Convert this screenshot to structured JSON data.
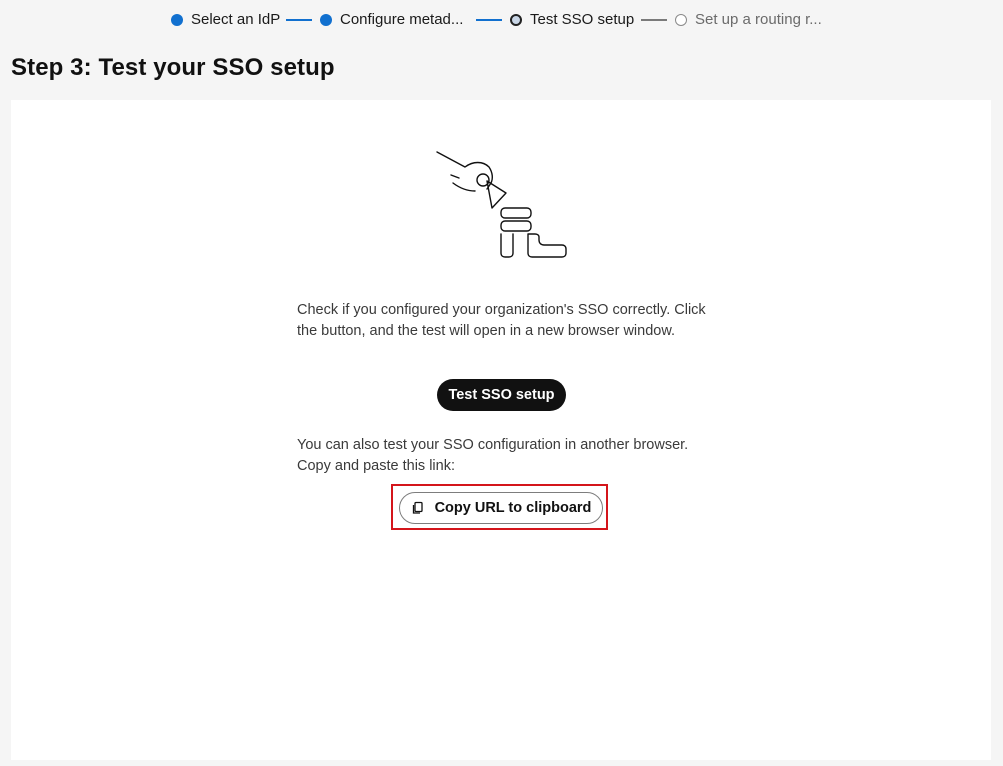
{
  "stepper": {
    "steps": [
      {
        "label": "Select an IdP",
        "state": "done"
      },
      {
        "label": "Configure metad...",
        "state": "done"
      },
      {
        "label": "Test SSO setup",
        "state": "current"
      },
      {
        "label": "Set up a routing r...",
        "state": "todo"
      }
    ]
  },
  "page": {
    "title": "Step 3: Test your SSO setup"
  },
  "content": {
    "intro_text": "Check if you configured your organization's SSO correctly. Click the button, and the test will open in a new browser window.",
    "test_button_label": "Test SSO setup",
    "alt_text": "You can also test your SSO configuration in another browser. Copy and paste this link:",
    "copy_button_label": "Copy URL to clipboard",
    "copy_icon": "copy-icon"
  },
  "colors": {
    "accent": "#1170cf",
    "highlight": "#d4151b",
    "primary_button": "#111111"
  }
}
